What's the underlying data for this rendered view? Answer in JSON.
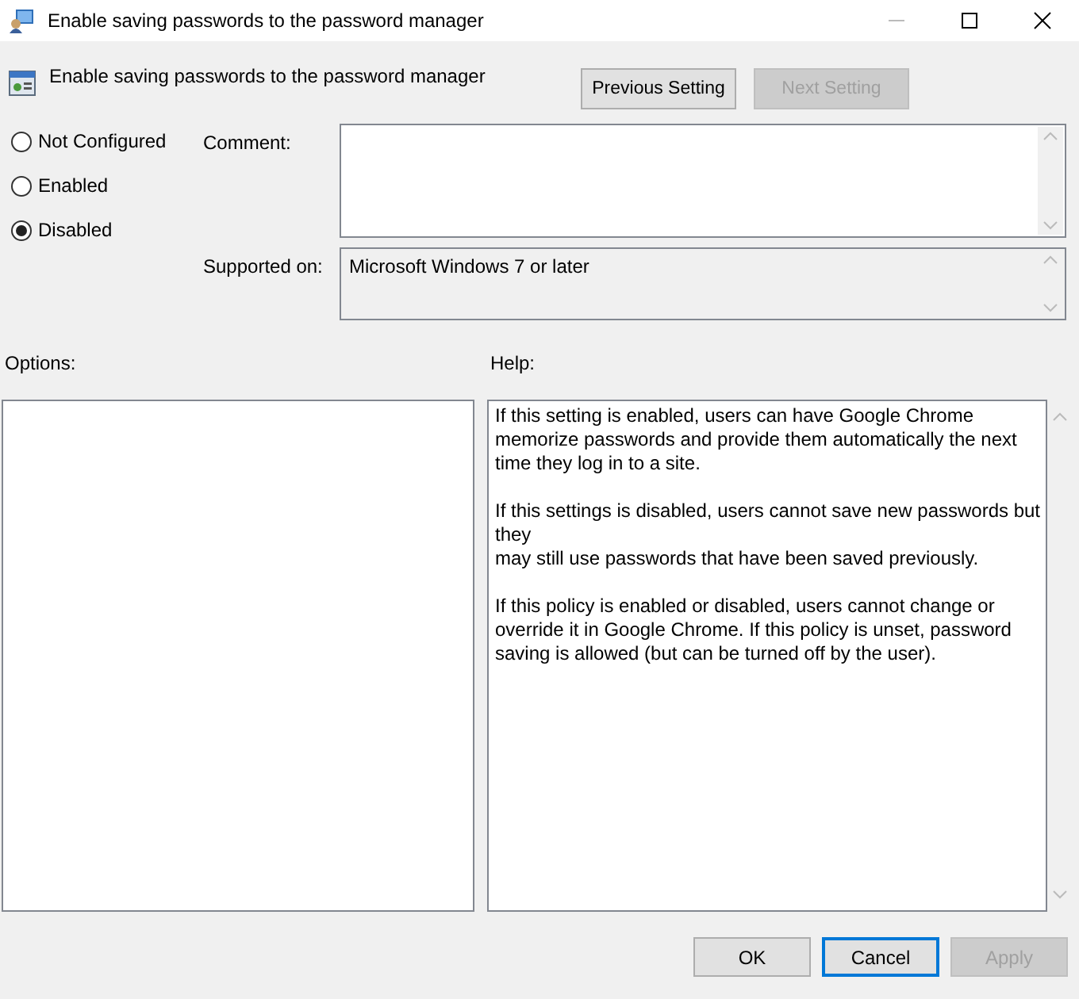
{
  "window": {
    "title": "Enable saving passwords to the password manager"
  },
  "header": {
    "title": "Enable saving passwords to the password manager"
  },
  "nav_buttons": [
    {
      "label": "Previous Setting",
      "disabled": false
    },
    {
      "label": "Next Setting",
      "disabled": true
    }
  ],
  "state_options": [
    {
      "label": "Not Configured",
      "selected": false
    },
    {
      "label": "Enabled",
      "selected": false
    },
    {
      "label": "Disabled",
      "selected": true
    }
  ],
  "comment": {
    "label": "Comment:"
  },
  "supported_on": {
    "label": "Supported on:",
    "value": "Microsoft Windows 7 or later"
  },
  "options": {
    "label": "Options:"
  },
  "help": {
    "label": "Help:",
    "paragraphs": [
      [
        "If this setting is enabled, users can have Google Chrome",
        "memorize passwords and provide them automatically the next",
        "time they log in to a site."
      ],
      [
        "If this settings is disabled, users cannot save new passwords but",
        "they",
        "may still use passwords that have been saved previously."
      ],
      [
        "If this policy is enabled or disabled, users cannot change or",
        "override it in Google Chrome. If this policy is unset, password",
        "saving is allowed (but can be turned off by the user)."
      ]
    ]
  },
  "buttons": [
    {
      "label": "OK",
      "disabled": false,
      "focused": false
    },
    {
      "label": "Cancel",
      "disabled": false,
      "focused": true
    },
    {
      "label": "Apply",
      "disabled": true,
      "focused": false
    }
  ]
}
